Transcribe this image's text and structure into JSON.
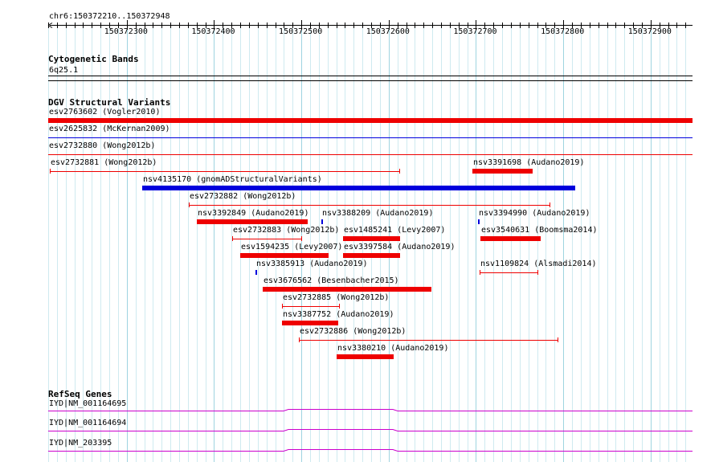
{
  "view": {
    "location": "chr6:150372210..150372948",
    "start": 150372210,
    "end": 150372948
  },
  "ruler": {
    "ticks": [
      "150372300",
      "150372400",
      "150372500",
      "150372600",
      "150372700",
      "150372800",
      "150372900"
    ]
  },
  "cytoband": {
    "title": "Cytogenetic Bands",
    "band": "6q25.1"
  },
  "dgv": {
    "title": "DGV Structural Variants",
    "colors": {
      "red": "#ee0000",
      "blue": "#0000dd"
    },
    "features": [
      {
        "name": "esv2763602 (Vogler2010)",
        "start": 150372210,
        "end": 150372948,
        "style": "box",
        "color": "red",
        "row": 0
      },
      {
        "name": "esv2625832 (McKernan2009)",
        "start": 150372210,
        "end": 150372948,
        "style": "line",
        "color": "blue",
        "row": 1
      },
      {
        "name": "esv2732880 (Wong2012b)",
        "start": 150372210,
        "end": 150372948,
        "style": "line",
        "color": "red",
        "row": 2
      },
      {
        "name": "esv2732881 (Wong2012b)",
        "start": 150372212,
        "end": 150372613,
        "style": "bracket",
        "color": "red",
        "row": 3
      },
      {
        "name": "nsv3391698 (Audano2019)",
        "start": 150372696,
        "end": 150372765,
        "style": "box",
        "color": "red",
        "row": 3
      },
      {
        "name": "nsv4135170 (gnomADStructuralVariants)",
        "start": 150372318,
        "end": 150372814,
        "style": "box",
        "color": "blue",
        "row": 4
      },
      {
        "name": "esv2732882 (Wong2012b)",
        "start": 150372371,
        "end": 150372785,
        "style": "bracket",
        "color": "red",
        "row": 5
      },
      {
        "name": "nsv3392849 (Audano2019)",
        "start": 150372380,
        "end": 150372507,
        "style": "box",
        "color": "red",
        "row": 6
      },
      {
        "name": "nsv3388209 (Audano2019)",
        "start": 150372523,
        "end": 150372525,
        "style": "box",
        "color": "blue",
        "row": 6
      },
      {
        "name": "nsv3394990 (Audano2019)",
        "start": 150372702,
        "end": 150372704,
        "style": "box",
        "color": "blue",
        "row": 6
      },
      {
        "name": "esv2732883 (Wong2012b)",
        "start": 150372421,
        "end": 150372501,
        "style": "bracket",
        "color": "red",
        "row": 7
      },
      {
        "name": "esv1485241 (Levy2007)",
        "start": 150372548,
        "end": 150372613,
        "style": "box",
        "color": "red",
        "row": 7
      },
      {
        "name": "esv3540631 (Boomsma2014)",
        "start": 150372705,
        "end": 150372774,
        "style": "box",
        "color": "red",
        "row": 7
      },
      {
        "name": "esv1594235 (Levy2007)",
        "start": 150372430,
        "end": 150372531,
        "style": "box",
        "color": "red",
        "row": 8
      },
      {
        "name": "esv3397584 (Audano2019)",
        "start": 150372548,
        "end": 150372613,
        "style": "box",
        "color": "red",
        "row": 8
      },
      {
        "name": "nsv3385913 (Audano2019)",
        "start": 150372447,
        "end": 150372449,
        "style": "box",
        "color": "blue",
        "row": 9
      },
      {
        "name": "nsv1109824 (Alsmadi2014)",
        "start": 150372704,
        "end": 150372771,
        "style": "bracket",
        "color": "red",
        "row": 9
      },
      {
        "name": "esv3676562 (Besenbacher2015)",
        "start": 150372456,
        "end": 150372649,
        "style": "box",
        "color": "red",
        "row": 10
      },
      {
        "name": "esv2732885 (Wong2012b)",
        "start": 150372478,
        "end": 150372544,
        "style": "bracket",
        "color": "red",
        "row": 11
      },
      {
        "name": "nsv3387752 (Audano2019)",
        "start": 150372478,
        "end": 150372542,
        "style": "box",
        "color": "red",
        "row": 12
      },
      {
        "name": "esv2732886 (Wong2012b)",
        "start": 150372497,
        "end": 150372794,
        "style": "bracket",
        "color": "red",
        "row": 13
      },
      {
        "name": "nsv3380210 (Audano2019)",
        "start": 150372540,
        "end": 150372606,
        "style": "box",
        "color": "red",
        "row": 14
      }
    ]
  },
  "refseq": {
    "title": "RefSeq Genes",
    "color": "#cc00cc",
    "genes": [
      {
        "name": "IYD|NM_001164695"
      },
      {
        "name": "IYD|NM_001164694"
      },
      {
        "name": "IYD|NM_203395"
      }
    ]
  }
}
